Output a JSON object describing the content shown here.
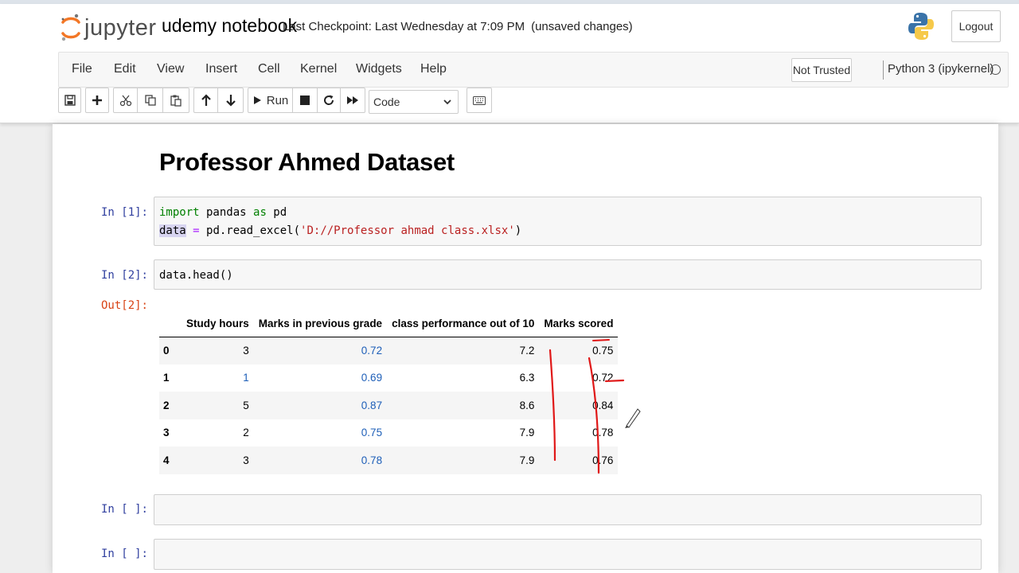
{
  "header": {
    "logo_text": "jupyter",
    "notebook_name": "udemy notebook",
    "checkpoint": "Last Checkpoint: Last Wednesday at 7:09 PM",
    "unsaved": "(unsaved changes)",
    "logout_label": "Logout"
  },
  "menubar": {
    "items": [
      "File",
      "Edit",
      "View",
      "Insert",
      "Cell",
      "Kernel",
      "Widgets",
      "Help"
    ],
    "trust_label": "Not Trusted",
    "kernel_name": "Python 3 (ipykernel)"
  },
  "toolbar": {
    "run_label": "Run",
    "cell_type": "Code",
    "icons": [
      "save-icon",
      "plus-icon",
      "cut-icon",
      "copy-icon",
      "paste-icon",
      "arrow-up-icon",
      "arrow-down-icon",
      "run-icon",
      "stop-icon",
      "restart-icon",
      "fast-forward-icon",
      "keyboard-icon"
    ]
  },
  "notebook": {
    "heading": "Professor Ahmed Dataset",
    "cell1": {
      "prompt": "In [1]:",
      "line1": {
        "kw1": "import",
        "mid": " pandas ",
        "kw2": "as",
        "end": " pd"
      },
      "line2": {
        "var": "data",
        "op": " = ",
        "call": "pd.read_excel(",
        "arg": "'D://Professor ahmad class.xlsx'",
        "close": ")"
      }
    },
    "cell2": {
      "prompt": "In [2]:",
      "code": "data.head()",
      "out_prompt": "Out[2]:"
    },
    "cell3": {
      "prompt": "In [ ]:"
    },
    "cell4": {
      "prompt": "In [ ]:"
    }
  },
  "dataframe": {
    "columns": [
      "",
      "Study hours",
      "Marks in previous grade",
      "class performance out of 10",
      "Marks scored"
    ],
    "rows": [
      [
        "0",
        "3",
        "0.72",
        "7.2",
        "0.75"
      ],
      [
        "1",
        "1",
        "0.69",
        "6.3",
        "0.72"
      ],
      [
        "2",
        "5",
        "0.87",
        "8.6",
        "0.84"
      ],
      [
        "3",
        "2",
        "0.75",
        "7.9",
        "0.78"
      ],
      [
        "4",
        "3",
        "0.78",
        "7.9",
        "0.76"
      ]
    ]
  },
  "colors": {
    "in_prompt": "#303f9f",
    "out_prompt": "#d84315",
    "keyword": "#008000",
    "string": "#ba2121",
    "operator": "#aa22ff",
    "annotation": "#e01818"
  }
}
